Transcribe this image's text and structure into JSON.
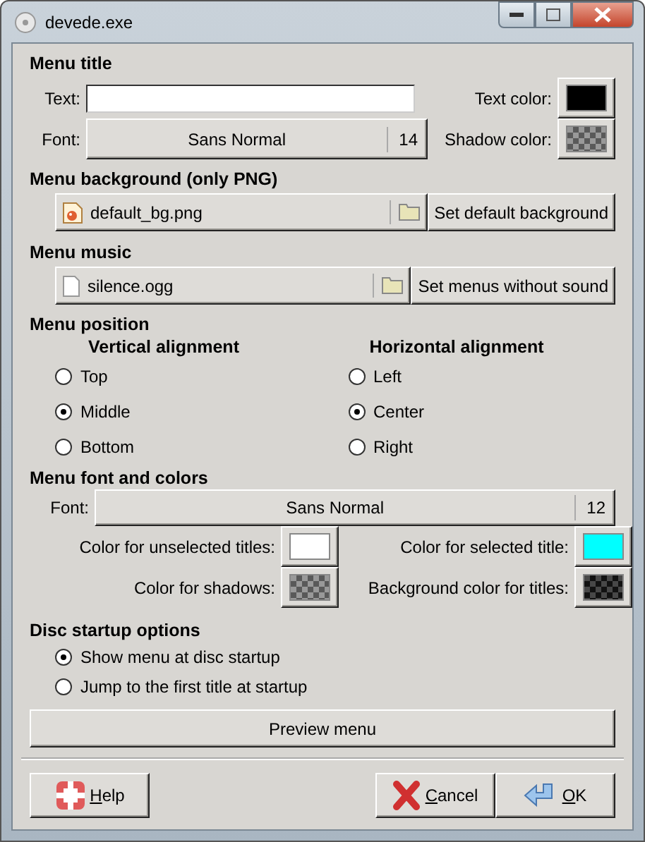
{
  "window": {
    "title": "devede.exe"
  },
  "menu_title": {
    "heading": "Menu title",
    "text_label": "Text:",
    "font_label": "Font:",
    "font_name": "Sans Normal",
    "font_size": "14",
    "colors": [
      {
        "label": "Text color:",
        "color": "#000000",
        "transparent": false
      },
      {
        "label": "Shadow color:",
        "color": "#808080",
        "transparent": true
      }
    ]
  },
  "menu_background": {
    "heading": "Menu background (only PNG)",
    "file": "default_bg.png",
    "kind": "image",
    "button": "Set default background"
  },
  "menu_music": {
    "heading": "Menu music",
    "file": "silence.ogg",
    "kind": "document",
    "button": "Set menus without sound"
  },
  "menu_position": {
    "heading": "Menu position",
    "groups": [
      {
        "title": "Vertical alignment",
        "options": [
          {
            "label": "Top",
            "selected": false
          },
          {
            "label": "Middle",
            "selected": true
          },
          {
            "label": "Bottom",
            "selected": false
          }
        ]
      },
      {
        "title": "Horizontal alignment",
        "options": [
          {
            "label": "Left",
            "selected": false
          },
          {
            "label": "Center",
            "selected": true
          },
          {
            "label": "Right",
            "selected": false
          }
        ]
      }
    ]
  },
  "menu_font": {
    "heading": "Menu font and colors",
    "font_label": "Font:",
    "font_name": "Sans Normal",
    "font_size": "12",
    "colors": [
      {
        "label": "Color for unselected titles:",
        "color": "#ffffff",
        "transparent": false
      },
      {
        "label": "Color for selected title:",
        "color": "#00ffff",
        "transparent": false
      },
      {
        "label": "Color for shadows:",
        "color": "#808080",
        "transparent": true
      },
      {
        "label": "Background color for titles:",
        "color": "#1a1a1a",
        "transparent": true
      }
    ]
  },
  "disc_startup": {
    "heading": "Disc startup options",
    "options": [
      {
        "label": "Show menu at disc startup",
        "selected": true
      },
      {
        "label": "Jump to the first title at startup",
        "selected": false
      }
    ]
  },
  "preview_button": "Preview menu",
  "buttons": [
    {
      "label": "Help",
      "kind": "help"
    },
    {
      "label": "Cancel",
      "kind": "cancel"
    },
    {
      "label": "OK",
      "kind": "ok"
    }
  ]
}
